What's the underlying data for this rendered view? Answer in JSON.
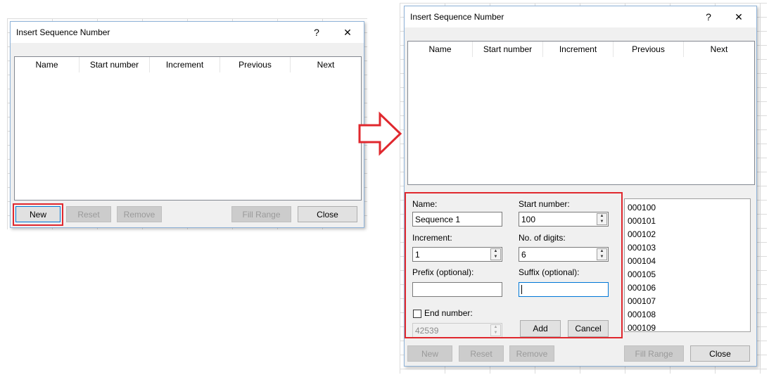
{
  "colors": {
    "highlight": "#e0282e",
    "dialog_bg": "#f0f0f0",
    "border_blue": "#8fb3d9",
    "focus_blue": "#0078d7"
  },
  "dialog_small": {
    "title": "Insert Sequence Number",
    "help": "?",
    "close": "✕",
    "columns": [
      "Name",
      "Start number",
      "Increment",
      "Previous",
      "Next"
    ],
    "buttons": {
      "new": "New",
      "reset": "Reset",
      "remove": "Remove",
      "fill_range": "Fill Range",
      "close": "Close"
    }
  },
  "dialog_large": {
    "title": "Insert Sequence Number",
    "help": "?",
    "close": "✕",
    "columns": [
      "Name",
      "Start number",
      "Increment",
      "Previous",
      "Next"
    ],
    "form": {
      "name_label": "Name:",
      "name_value": "Sequence 1",
      "start_label": "Start number:",
      "start_value": "100",
      "increment_label": "Increment:",
      "increment_value": "1",
      "digits_label": "No. of digits:",
      "digits_value": "6",
      "prefix_label": "Prefix (optional):",
      "prefix_value": "",
      "suffix_label": "Suffix (optional):",
      "suffix_value": "",
      "end_label": "End number:",
      "end_checked": false,
      "end_value": "42539",
      "add": "Add",
      "cancel": "Cancel"
    },
    "preview": [
      "000100",
      "000101",
      "000102",
      "000103",
      "000104",
      "000105",
      "000106",
      "000107",
      "000108",
      "000109"
    ],
    "buttons": {
      "new": "New",
      "reset": "Reset",
      "remove": "Remove",
      "fill_range": "Fill Range",
      "close": "Close"
    }
  },
  "icons": {
    "arrow": "right-arrow-icon",
    "spin": "spin-up-down-icon"
  }
}
